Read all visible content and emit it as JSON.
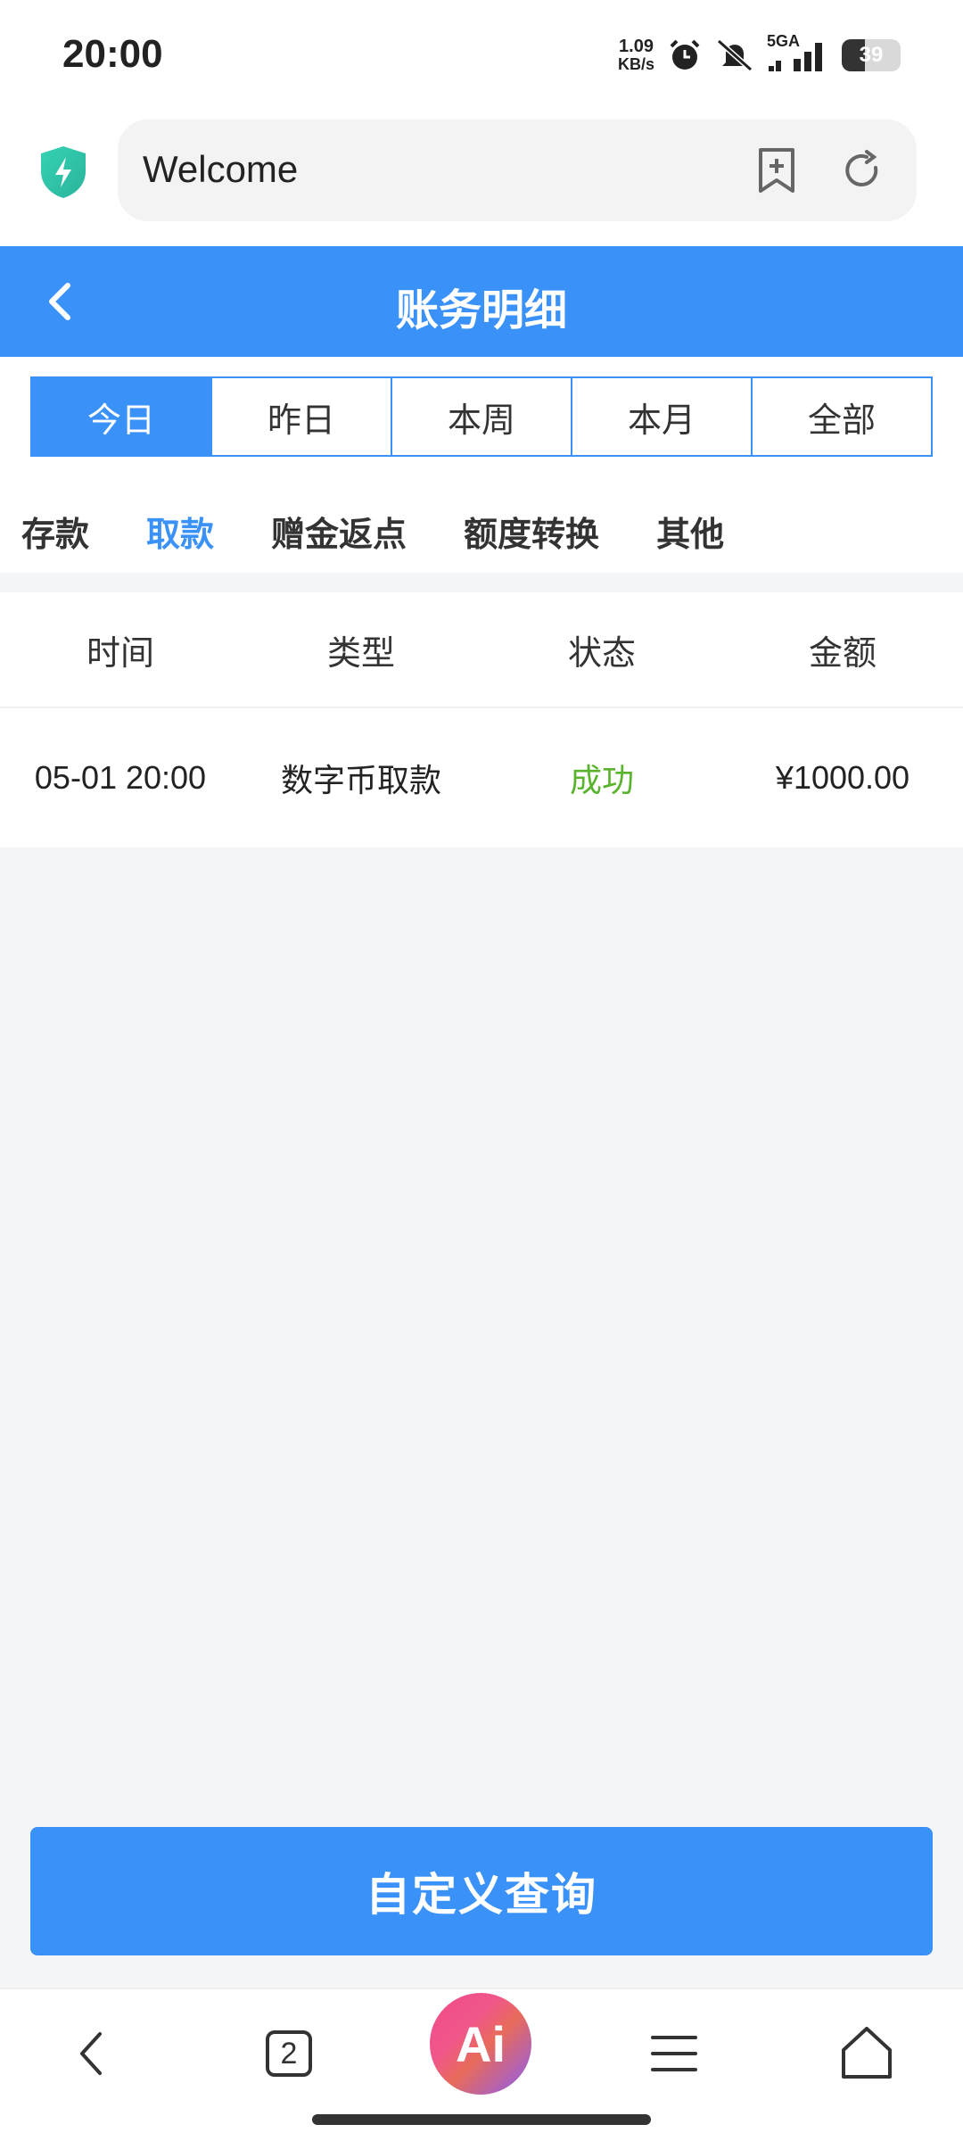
{
  "status_bar": {
    "time": "20:00",
    "net_speed_value": "1.09",
    "net_speed_unit": "KB/s",
    "network": "5GA",
    "battery": "39",
    "battery_level": 0.39,
    "icons": [
      "alarm-icon",
      "mute-icon",
      "signal-icon",
      "battery-icon"
    ]
  },
  "browser": {
    "url_text": "Welcome",
    "icons": [
      "shield-icon",
      "add-bookmark-icon",
      "reload-icon"
    ]
  },
  "header": {
    "title": "账务明细"
  },
  "period_tabs": [
    {
      "label": "今日",
      "active": true
    },
    {
      "label": "昨日",
      "active": false
    },
    {
      "label": "本周",
      "active": false
    },
    {
      "label": "本月",
      "active": false
    },
    {
      "label": "全部",
      "active": false
    }
  ],
  "type_tabs": [
    {
      "label": "存款",
      "active": false
    },
    {
      "label": "取款",
      "active": true
    },
    {
      "label": "赠金返点",
      "active": false
    },
    {
      "label": "额度转换",
      "active": false
    },
    {
      "label": "其他",
      "active": false
    }
  ],
  "table": {
    "headers": [
      "时间",
      "类型",
      "状态",
      "金额"
    ],
    "rows": [
      {
        "time": "05-01 20:00",
        "type": "数字币取款",
        "status": "成功",
        "amount": "¥1000.00"
      }
    ]
  },
  "query_button": "自定义查询",
  "bottom_nav": {
    "tab_count": "2",
    "ai_label": "Ai"
  },
  "colors": {
    "primary": "#3a92f9",
    "success": "#5ab32d",
    "background": "#f4f5f7"
  }
}
